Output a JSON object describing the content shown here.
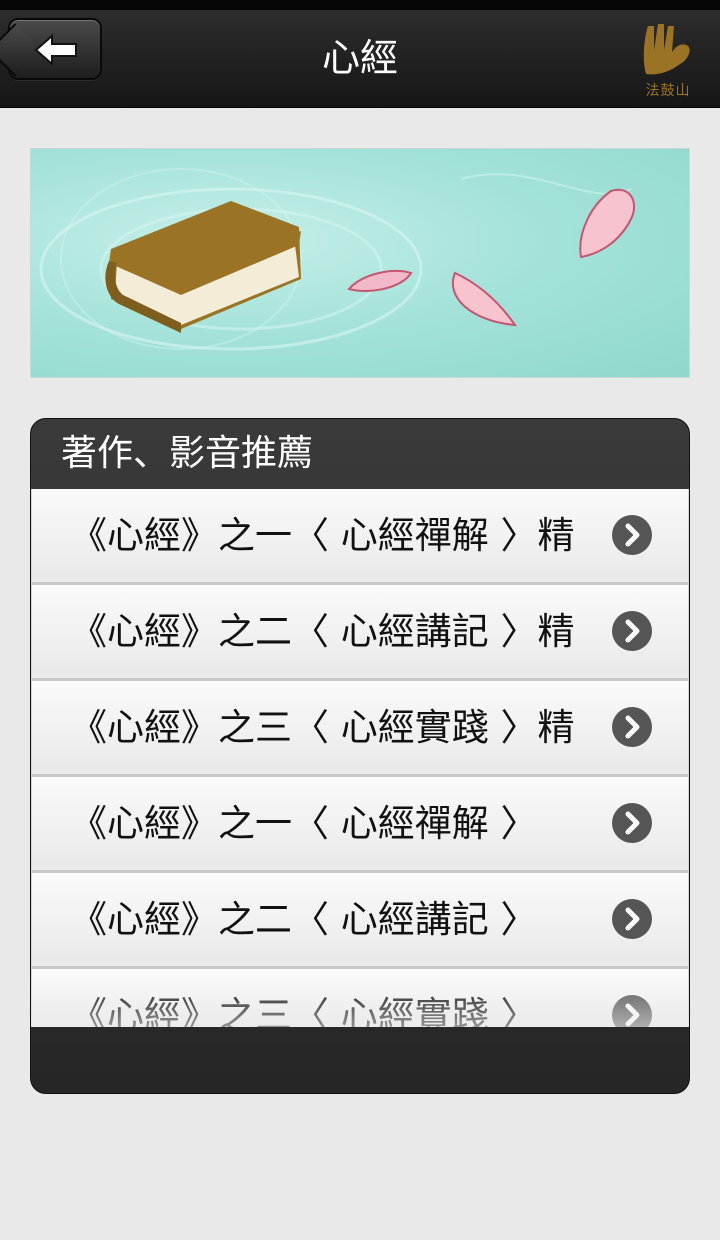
{
  "header": {
    "title": "心經",
    "back_icon": "left-arrow-icon",
    "logo_text": "法鼓山"
  },
  "banner": {
    "description_icon": "book-and-petals-illustration"
  },
  "panel": {
    "title": "著作、影音推薦",
    "items": [
      {
        "label": "《心經》之一〈 心經禪解 〉精"
      },
      {
        "label": "《心經》之二〈 心經講記 〉精"
      },
      {
        "label": "《心經》之三〈 心經實踐 〉精"
      },
      {
        "label": "《心經》之一〈 心經禪解 〉"
      },
      {
        "label": "《心經》之二〈 心經講記 〉"
      },
      {
        "label": "《心經》之三〈 心經實踐 〉"
      }
    ]
  },
  "colors": {
    "header_bg": "#1e1e1e",
    "accent_gold": "#9a7424",
    "banner_bg": "#a6e3da"
  }
}
